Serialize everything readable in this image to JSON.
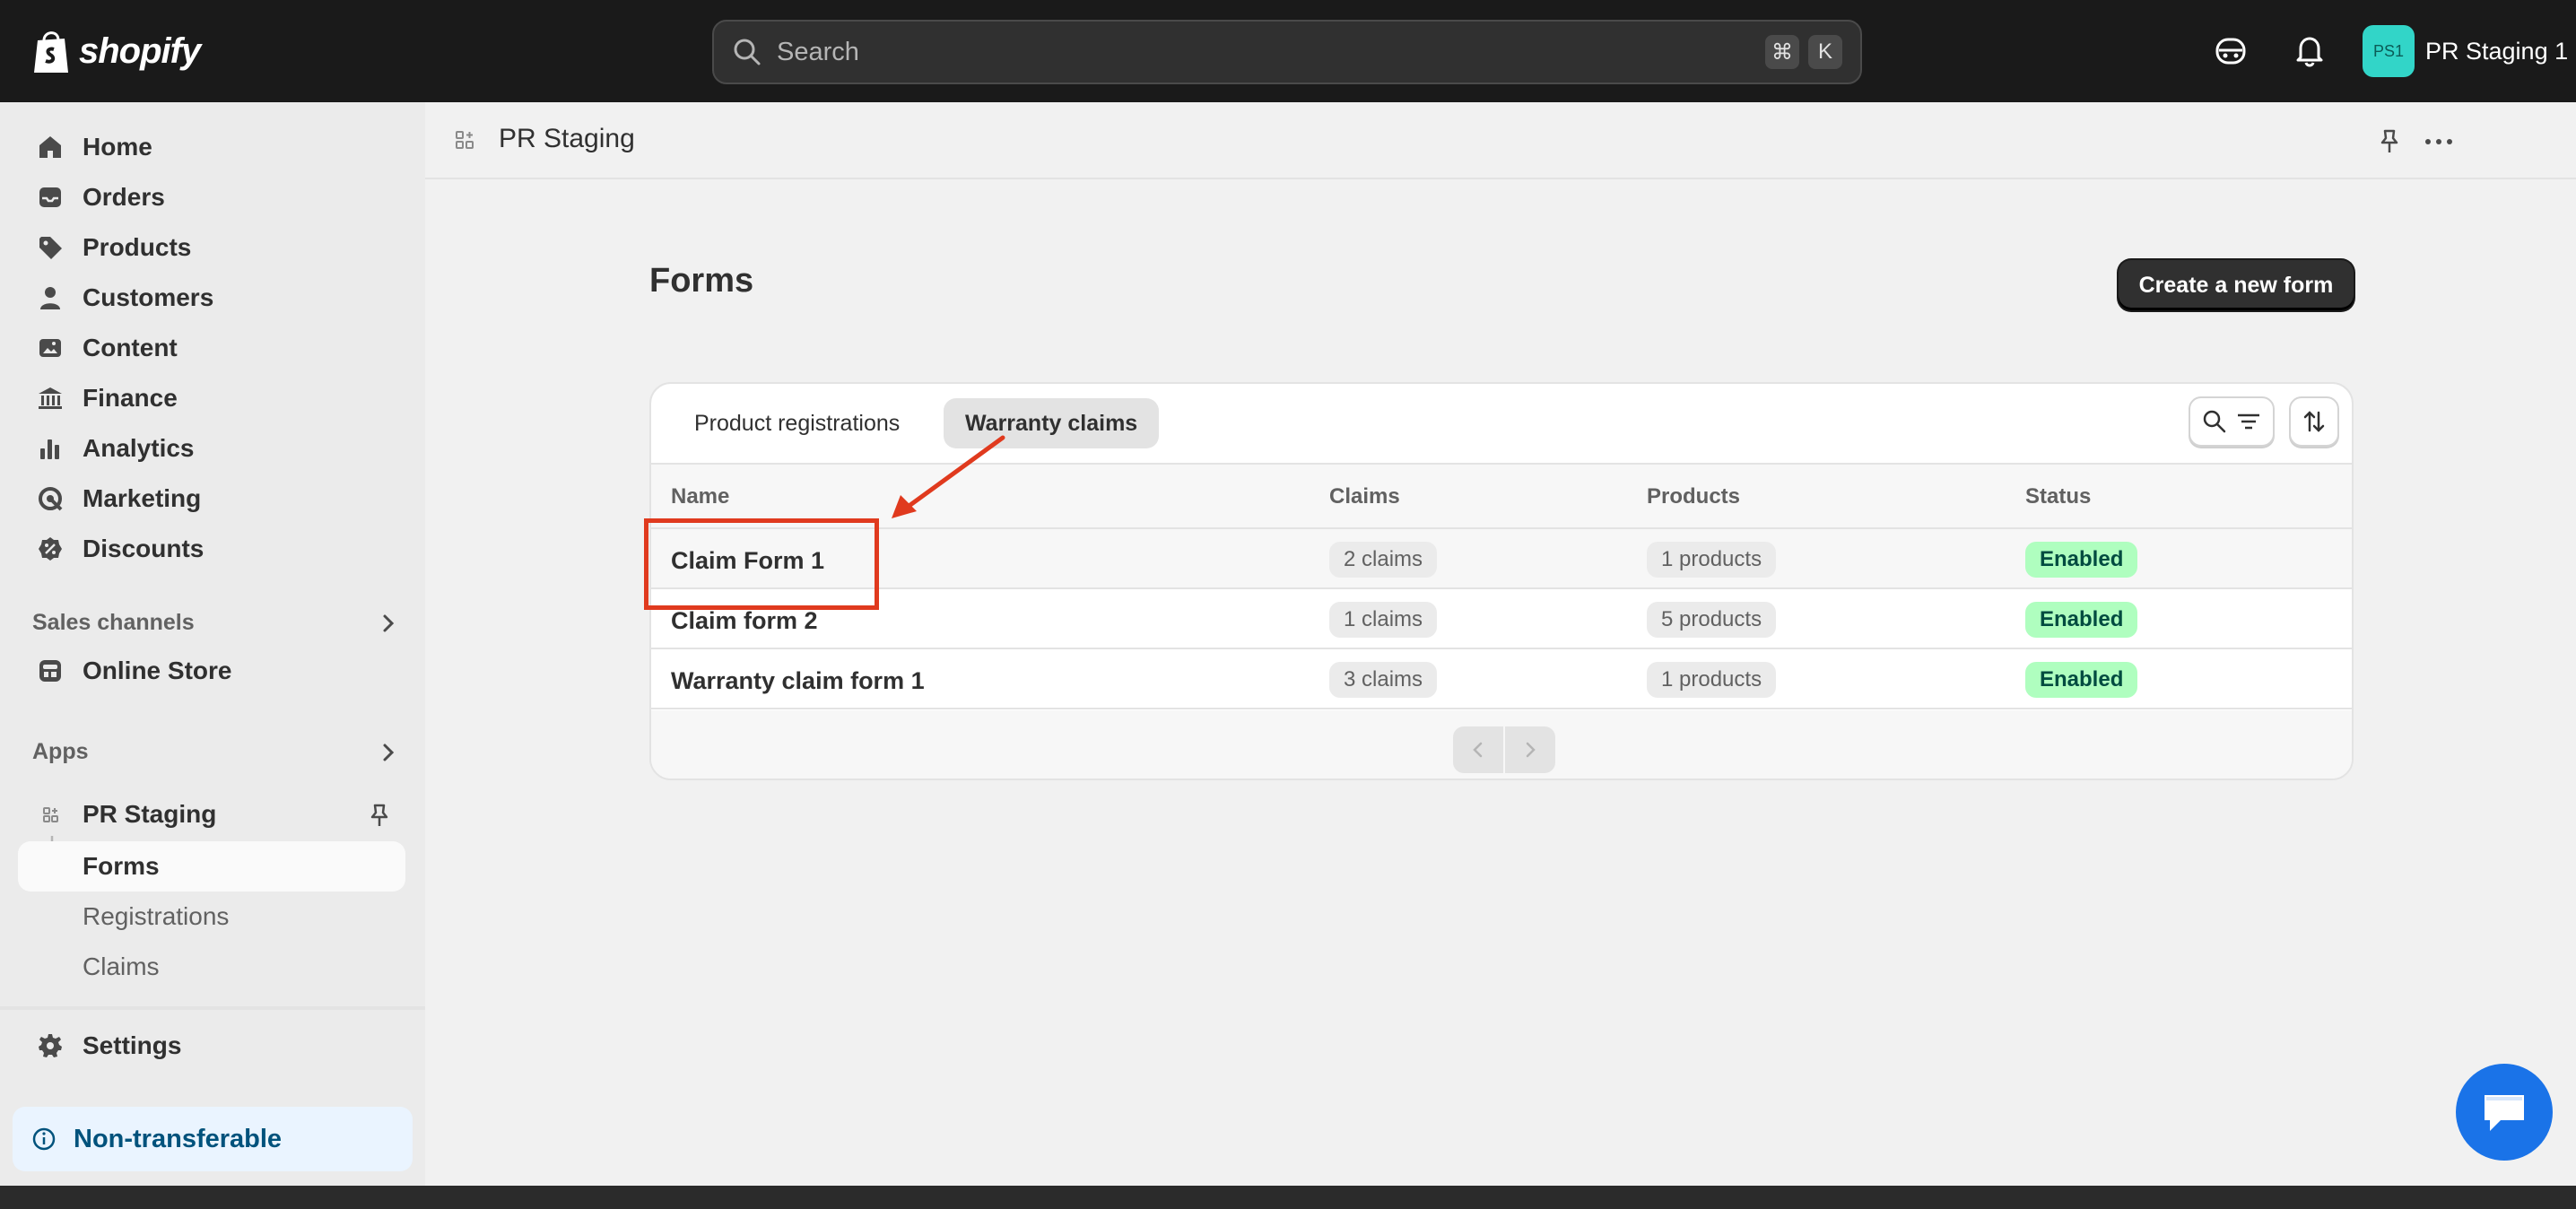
{
  "topbar": {
    "logo_text": "shopify",
    "search_placeholder": "Search",
    "shortcut_keys": [
      "⌘",
      "K"
    ],
    "store_initials": "PS1",
    "store_name": "PR Staging 1"
  },
  "sidebar": {
    "nav": [
      {
        "label": "Home",
        "icon": "home-icon"
      },
      {
        "label": "Orders",
        "icon": "inbox-icon"
      },
      {
        "label": "Products",
        "icon": "tag-icon"
      },
      {
        "label": "Customers",
        "icon": "person-icon"
      },
      {
        "label": "Content",
        "icon": "image-icon"
      },
      {
        "label": "Finance",
        "icon": "bank-icon"
      },
      {
        "label": "Analytics",
        "icon": "bar-chart-icon"
      },
      {
        "label": "Marketing",
        "icon": "target-icon"
      },
      {
        "label": "Discounts",
        "icon": "discount-icon"
      }
    ],
    "sales_channels_title": "Sales channels",
    "online_store": "Online Store",
    "apps_title": "Apps",
    "app_name": "PR Staging",
    "app_sub": [
      "Forms",
      "Registrations",
      "Claims"
    ],
    "active_sub": "Forms",
    "settings": "Settings",
    "non_transferable": "Non-transferable"
  },
  "main": {
    "app_title": "PR Staging",
    "page_title": "Forms",
    "create_button": "Create a new form",
    "tabs": [
      "Product registrations",
      "Warranty claims"
    ],
    "active_tab": "Warranty claims",
    "columns": [
      "Name",
      "Claims",
      "Products",
      "Status"
    ],
    "rows": [
      {
        "name": "Claim Form 1",
        "claims": "2 claims",
        "products": "1 products",
        "status": "Enabled"
      },
      {
        "name": "Claim form 2",
        "claims": "1 claims",
        "products": "5 products",
        "status": "Enabled"
      },
      {
        "name": "Warranty claim form 1",
        "claims": "3 claims",
        "products": "1 products",
        "status": "Enabled"
      }
    ]
  },
  "colors": {
    "topbar": "#1a1a1a",
    "accent_teal": "#32d5c8",
    "status_green": "#affebf",
    "annotation_red": "#e03a1e",
    "chat_blue": "#1a73e8"
  }
}
